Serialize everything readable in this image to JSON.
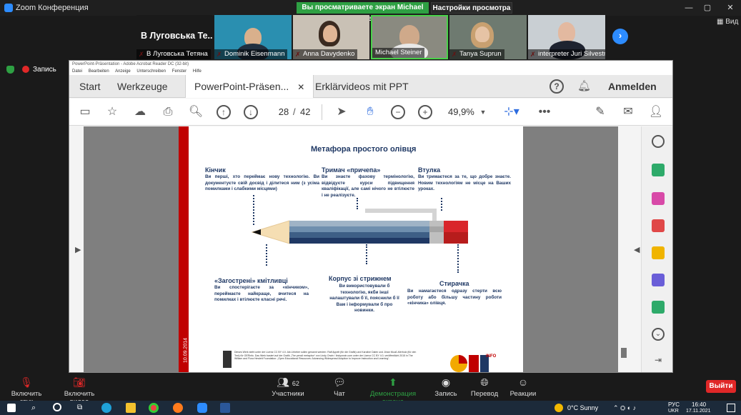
{
  "zoom": {
    "app_title": "Zoom Конференция",
    "share_banner": "Вы просматриваете экран Michael Steiner",
    "view_options": "Настройки просмотра ⌄",
    "view_button": "Вид",
    "recording": "Запись",
    "participants": [
      {
        "name": "В Луговська Тетяна",
        "big_label": "В Луговська Те...",
        "muted": true
      },
      {
        "name": "Dominik Eisenmann",
        "muted": true
      },
      {
        "name": "Anna Davydenko",
        "muted": true
      },
      {
        "name": "Michael Steiner",
        "muted": false
      },
      {
        "name": "Tanya Suprun",
        "muted": true
      },
      {
        "name": "interpreter Juri Silvestr...",
        "muted": true
      }
    ],
    "bottom": {
      "mute": "Включить звук",
      "video": "Включить видео",
      "participants": "Участники",
      "participants_count": "62",
      "chat": "Чат",
      "share": "Демонстрация экрана",
      "record": "Запись",
      "translate": "Перевод",
      "reactions": "Реакции",
      "leave": "Выйти"
    }
  },
  "acrobat": {
    "window_title": "PowerPoint-Präsentation - Adobe Acrobat Reader DC (32-bit)",
    "menu": [
      "Datei",
      "Bearbeiten",
      "Anzeige",
      "Unterschreiben",
      "Fenster",
      "Hilfe"
    ],
    "tabs": {
      "start": "Start",
      "tools": "Werkzeuge",
      "doc1": "PowerPoint-Präsen...",
      "doc2": "Erklärvideos mit PPT"
    },
    "sign_in": "Anmelden",
    "page_current": "28",
    "page_sep": "/",
    "page_total": "42",
    "zoom": "49,9%"
  },
  "slide": {
    "title": "Метафора простого олівця",
    "date": "10.09.2014",
    "sections": {
      "tip": {
        "head": "Кінчик",
        "body": "Ви перші, хто переймає нову технологію. Ви документуєте свій досвід і ділитеся ним (з усіма помилками і слабкими місцями)"
      },
      "holder": {
        "head": "Тримач «причепа»",
        "body": "Ви знаєте фахову термінологію, відвідуєте курси підвищення кваліфікації, але самі нічого не втілюєте і не реалізуєте."
      },
      "ferrule": {
        "head": "Втулка",
        "body": "Ви тримаєтеся за те, що добре знаєте. Новим технологіям не місце на Ваших уроках."
      },
      "shavings": {
        "head": "«Загострені» кмітливці",
        "body": "Ви спостерігаєте за «кінчиком», переймаєте найкраще, вчитеся на помилках і втілюєте класні речі."
      },
      "body": {
        "head": "Корпус зі стрижнем",
        "body": "Ви використовували б технологію, якби інші налаштували б її, пояснили б її Вам і інформували б про новинки."
      },
      "eraser": {
        "head": "Стирачка",
        "body": "Ви намагаєтеся одразу стерти всю роботу або більшу частину роботи «кінчика» олівця."
      }
    },
    "footer_text": "Dieses Werk steht unter der Lizenz CC BY 4.0. Als Urheber sollen genannt werden: Ralf Appelt (für die Grafik) und Karoline Dalen und Jöran Muuß-Merholz (für den Text) für OERinfo. Das Werk basiert auf der Grafik „The pencil metaphor“ von Lindy Orwin / lindyorwin.com unter der Lizenz CC BY 4.0, veröffentlicht 2015 in The William and Flora Hewlett Foundation: „Open Educational Resources: Advancing Widespread Adoption to Improve Instruction and Learning“.",
    "logo_text": "INFO"
  },
  "taskbar": {
    "weather": "0°C  Sunny",
    "lang1": "РУС",
    "lang2": "UKR",
    "time": "16:40",
    "date": "17.11.2021"
  },
  "colors": {
    "zoom_green": "#2ea043",
    "zoom_blue": "#2d8cff",
    "leave_red": "#e02828",
    "slide_red": "#c00000",
    "slide_navy": "#1f3864"
  }
}
